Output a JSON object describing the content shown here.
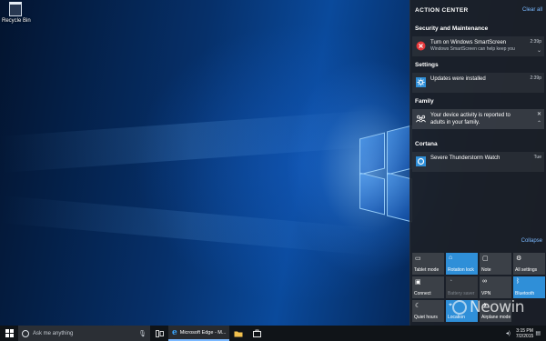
{
  "desktop": {
    "recycle_bin_label": "Recycle Bin"
  },
  "action_center": {
    "title": "ACTION CENTER",
    "clear_all": "Clear all",
    "groups": [
      {
        "title": "Security and Maintenance",
        "notification": {
          "icon": "error-icon",
          "title": "Turn on Windows SmartScreen",
          "body": "Windows SmartScreen can help keep you",
          "time": "2:39p"
        }
      },
      {
        "title": "Settings",
        "notification": {
          "icon": "gear-icon",
          "title": "Updates were installed",
          "time": "2:39p"
        }
      },
      {
        "title": "Family",
        "notification": {
          "icon": "family-icon",
          "title": "Your device activity is reported to adults in your family."
        }
      },
      {
        "title": "Cortana",
        "notification": {
          "icon": "cortana-icon",
          "title": "Severe Thunderstorm Watch",
          "time": "Tue"
        }
      }
    ],
    "collapse": "Collapse",
    "quick_actions": [
      {
        "label": "Tablet mode",
        "icon": "tablet-mode-icon",
        "state": "off"
      },
      {
        "label": "Rotation lock",
        "icon": "rotation-lock-icon",
        "state": "on"
      },
      {
        "label": "Note",
        "icon": "note-icon",
        "state": "off"
      },
      {
        "label": "All settings",
        "icon": "settings-icon",
        "state": "off"
      },
      {
        "label": "Connect",
        "icon": "connect-icon",
        "state": "off"
      },
      {
        "label": "Battery saver",
        "icon": "battery-saver-icon",
        "state": "disabled"
      },
      {
        "label": "VPN",
        "icon": "vpn-icon",
        "state": "off"
      },
      {
        "label": "Bluetooth",
        "icon": "bluetooth-icon",
        "state": "on"
      },
      {
        "label": "Quiet hours",
        "icon": "moon-icon",
        "state": "off"
      },
      {
        "label": "Location",
        "icon": "location-icon",
        "state": "on"
      },
      {
        "label": "Airplane mode",
        "icon": "airplane-icon",
        "state": "off"
      }
    ],
    "accent_color": "#2f8fd8"
  },
  "taskbar": {
    "search_placeholder": "Ask me anything",
    "edge_label": "Microsoft Edge - M...",
    "time": "3:15 PM",
    "date": "7/2/2015"
  },
  "watermark": "Neowin"
}
